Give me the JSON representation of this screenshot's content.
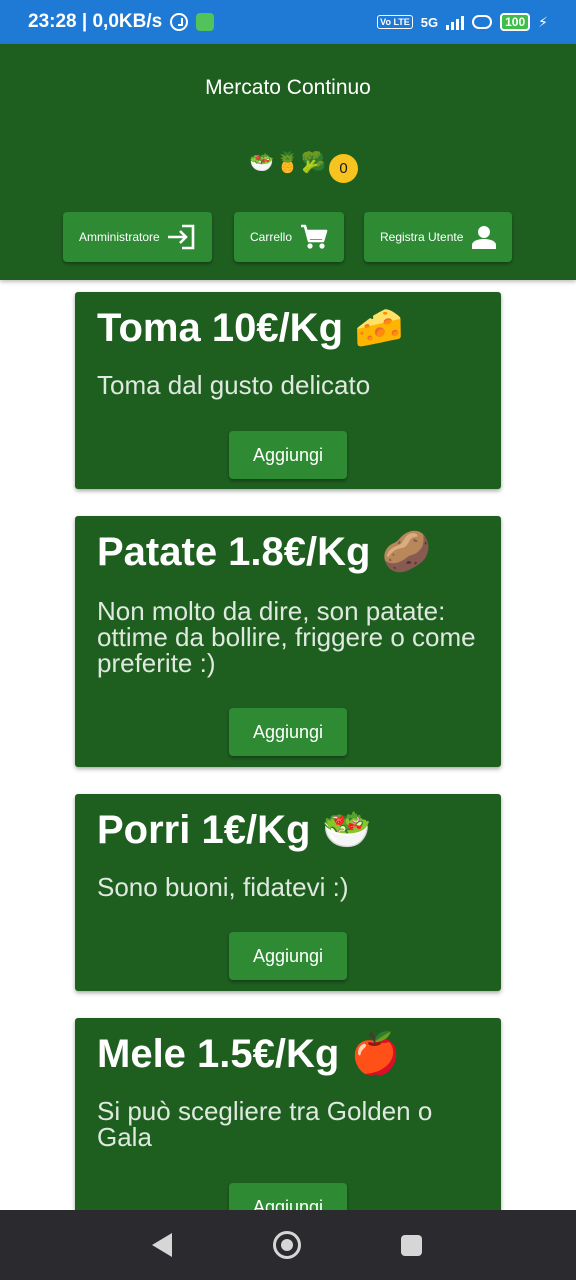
{
  "status_bar": {
    "time_speed": "23:28 | 0,0KB/s",
    "network_badge": "Vo LTE",
    "network_type": "5G",
    "battery": "100"
  },
  "header": {
    "title": "Mercato Continuo",
    "emojis": "🥗🍍🥦",
    "buttons": {
      "admin": "Amministratore",
      "cart": "Carrello",
      "register": "Registra Utente"
    },
    "cart_count": "0"
  },
  "products": [
    {
      "title": "Toma 10€/Kg 🧀",
      "description": "Toma dal gusto delicato",
      "button": "Aggiungi"
    },
    {
      "title": "Patate 1.8€/Kg 🥔",
      "description": "Non molto da dire, son patate: ottime da bollire, friggere o come preferite :)",
      "button": "Aggiungi"
    },
    {
      "title": "Porri 1€/Kg 🥗",
      "description": "Sono buoni, fidatevi :)",
      "button": "Aggiungi"
    },
    {
      "title": "Mele 1.5€/Kg 🍎",
      "description": "Si può scegliere tra Golden o Gala",
      "button": "Aggiungi"
    }
  ],
  "colors": {
    "status_bar": "#1f7ad6",
    "primary_dark": "#1e5f20",
    "button_green": "#2e8b34",
    "badge_yellow": "#f7c31e"
  }
}
